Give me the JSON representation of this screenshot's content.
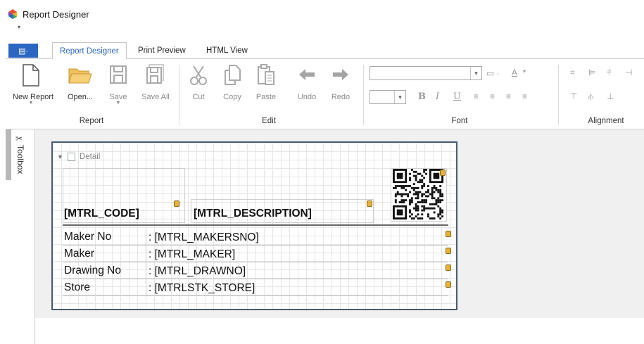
{
  "window": {
    "title": "Report Designer",
    "qat_glyph": "▾"
  },
  "tabs": {
    "file_glyph": "▤·",
    "items": [
      "Report Designer",
      "Print Preview",
      "HTML View"
    ]
  },
  "ribbon": {
    "report": {
      "label": "Report",
      "buttons": [
        "New Report",
        "Open...",
        "Save",
        "Save All"
      ]
    },
    "edit": {
      "label": "Edit",
      "buttons": [
        "Cut",
        "Copy",
        "Paste",
        "Undo",
        "Redo"
      ]
    },
    "font": {
      "label": "Font",
      "bold": "B",
      "italic": "I",
      "underline": "U",
      "color_glyph": "A"
    },
    "alignment": {
      "label": "Alignment"
    }
  },
  "toolbox": {
    "label": "Toolbox"
  },
  "report": {
    "band": "Detail",
    "code_field": "[MTRL_CODE]",
    "desc_field": "[MTRL_DESCRIPTION]",
    "rows": [
      {
        "label": "Maker No",
        "value": ": [MTRL_MAKERSNO]"
      },
      {
        "label": "Maker",
        "value": ": [MTRL_MAKER]"
      },
      {
        "label": "Drawing No",
        "value": ": [MTRL_DRAWNO]"
      },
      {
        "label": "Store",
        "value": ": [MTRLSTK_STORE]"
      }
    ]
  },
  "colors": {
    "accent": "#2a66c2",
    "knob": "#e7b13b",
    "frame": "#4b5a6e"
  }
}
